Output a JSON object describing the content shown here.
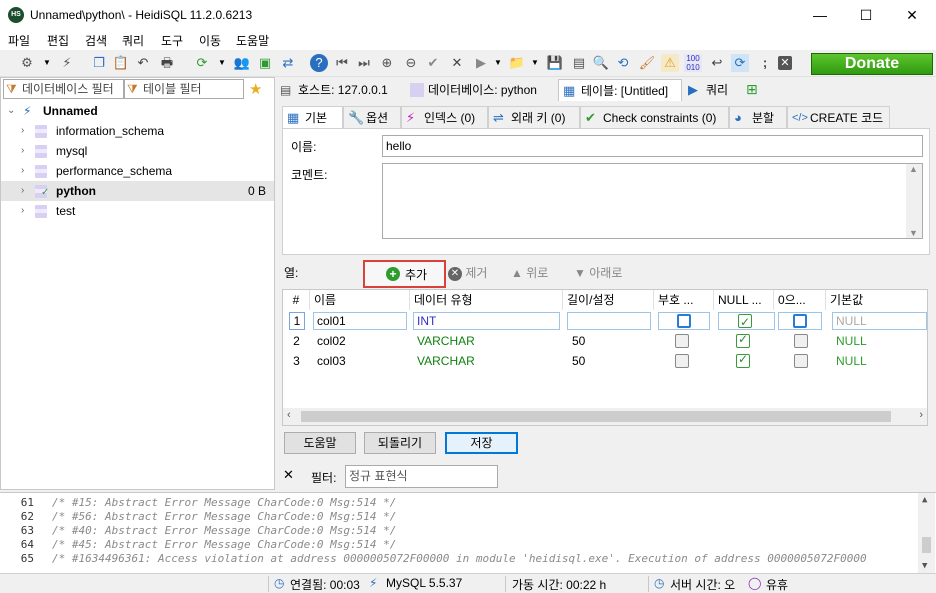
{
  "window": {
    "title": "Unnamed\\python\\ - HeidiSQL 11.2.0.6213",
    "app_icon_text": "HS"
  },
  "window_controls": {
    "minimize": "—",
    "maximize": "☐",
    "close": "✕"
  },
  "menu": [
    "파일",
    "편집",
    "검색",
    "쿼리",
    "도구",
    "이동",
    "도움말"
  ],
  "toolbar": {
    "donate_label": "Donate"
  },
  "left": {
    "db_filter_placeholder": "데이터베이스 필터",
    "table_filter_placeholder": "테이블 필터",
    "tree": [
      {
        "label": "Unnamed",
        "size": ""
      },
      {
        "label": "information_schema",
        "size": ""
      },
      {
        "label": "mysql",
        "size": ""
      },
      {
        "label": "performance_schema",
        "size": ""
      },
      {
        "label": "python",
        "size": "0 B"
      },
      {
        "label": "test",
        "size": ""
      }
    ]
  },
  "tabs": [
    {
      "label": "호스트: 127.0.0.1"
    },
    {
      "label": "데이터베이스: python"
    },
    {
      "label": "테이블: [Untitled]"
    },
    {
      "label": "쿼리"
    }
  ],
  "subtabs": [
    {
      "label": "기본"
    },
    {
      "label": "옵션"
    },
    {
      "label": "인덱스 (0)"
    },
    {
      "label": "외래 키 (0)"
    },
    {
      "label": "Check constraints (0)"
    },
    {
      "label": "분할"
    },
    {
      "label": "CREATE 코드"
    }
  ],
  "editor": {
    "name_label": "이름:",
    "name_value": "hello",
    "comment_label": "코멘트:",
    "comment_value": ""
  },
  "columns_toolbar": {
    "label": "열:",
    "add": "추가",
    "remove": "제거",
    "up": "위로",
    "down": "아래로"
  },
  "grid": {
    "headers": [
      "#",
      "이름",
      "데이터 유형",
      "길이/설정",
      "부호 ...",
      "NULL ...",
      "0으...",
      "기본값"
    ],
    "rows": [
      {
        "num": "1",
        "name": "col01",
        "type": "INT",
        "length": "",
        "unsigned": false,
        "null": true,
        "zerofill": false,
        "default": "NULL"
      },
      {
        "num": "2",
        "name": "col02",
        "type": "VARCHAR",
        "length": "50",
        "unsigned": false,
        "null": true,
        "zerofill": false,
        "default": "NULL"
      },
      {
        "num": "3",
        "name": "col03",
        "type": "VARCHAR",
        "length": "50",
        "unsigned": false,
        "null": true,
        "zerofill": false,
        "default": "NULL"
      }
    ]
  },
  "buttons": {
    "help": "도움말",
    "revert": "되돌리기",
    "save": "저장"
  },
  "filter": {
    "close": "✕",
    "label": "필터:",
    "placeholder": "정규 표현식"
  },
  "log": [
    {
      "num": "61",
      "text": "/* #15: Abstract Error Message CharCode:0 Msg:514 */"
    },
    {
      "num": "62",
      "text": "/* #56: Abstract Error Message CharCode:0 Msg:514 */"
    },
    {
      "num": "63",
      "text": "/* #40: Abstract Error Message CharCode:0 Msg:514 */"
    },
    {
      "num": "64",
      "text": "/* #45: Abstract Error Message CharCode:0 Msg:514 */"
    },
    {
      "num": "65",
      "text": "/* #1634496361: Access violation at address 0000005072F00000 in module 'heidisql.exe'. Execution of address 0000005072F0000"
    }
  ],
  "status": {
    "connected": "연결됨: 00:03",
    "server": "MySQL 5.5.37",
    "uptime": "가동 시간: 00:22 h",
    "server_time": "서버 시간: 오",
    "idle": "유휴"
  },
  "colors": {
    "accent": "#0078d7",
    "donate": "#3aa81a",
    "highlight_border": "#d9423a",
    "null_green": "#2e9b2e",
    "type_blue": "#3030c0",
    "type_green": "#108010"
  }
}
